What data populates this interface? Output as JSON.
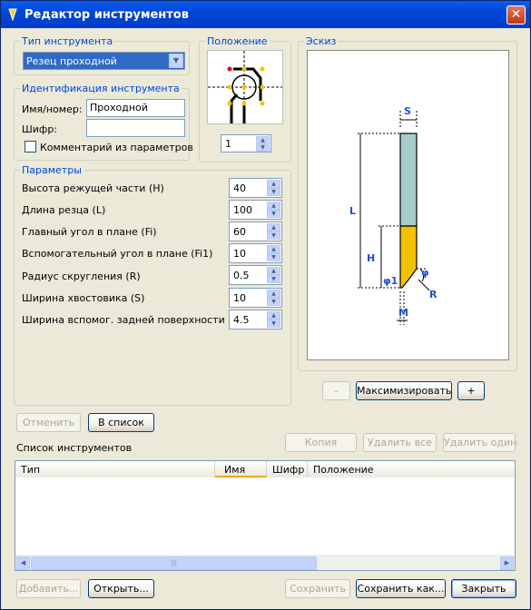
{
  "window": {
    "title": "Редактор инструментов",
    "close_glyph": "✕"
  },
  "tool_type": {
    "legend": "Тип инструмента",
    "selected": "Резец проходной"
  },
  "position": {
    "legend": "Положение",
    "value": "1"
  },
  "sketch": {
    "legend": "Эскиз",
    "labels": {
      "S": "S",
      "L": "L",
      "H": "H",
      "phi1": "φ1",
      "phi": "φ",
      "R": "R",
      "M": "M"
    }
  },
  "identification": {
    "legend": "Идентификация инструмента",
    "name_label": "Имя/номер:",
    "name_value": "Проходной",
    "code_label": "Шифр:",
    "code_value": "",
    "comment_label": "Комментарий из параметров",
    "comment_checked": false
  },
  "parameters": {
    "legend": "Параметры",
    "rows": [
      {
        "label": "Высота режущей части (H)",
        "value": "40"
      },
      {
        "label": "Длина резца (L)",
        "value": "100"
      },
      {
        "label": "Главный угол в плане (Fi)",
        "value": "60"
      },
      {
        "label": "Вспомогательный угол в плане (Fi1)",
        "value": "10"
      },
      {
        "label": "Радиус скругления (R)",
        "value": "0.5"
      },
      {
        "label": "Ширина хвостовика (S)",
        "value": "10"
      },
      {
        "label": "Ширина вспомог. задней поверхности (M)",
        "value": "4.5"
      }
    ]
  },
  "zoom": {
    "minus": "–",
    "maximize": "Максимизировать",
    "plus": "+"
  },
  "edit_buttons": {
    "cancel": "Отменить",
    "to_list": "В список"
  },
  "list_buttons": {
    "copy": "Копия",
    "delete_all": "Удалить все",
    "delete_one": "Удалить один"
  },
  "tool_list": {
    "label": "Список инструментов",
    "columns": [
      "Тип",
      "Имя",
      "Шифр",
      "Положение"
    ],
    "rows": []
  },
  "bottom_buttons": {
    "add": "Добавить...",
    "open": "Открыть...",
    "save": "Сохранить",
    "save_as": "Сохранить как...",
    "close": "Закрыть"
  },
  "colors": {
    "title_bar": "#0a52e0",
    "legend_text": "#0046d5",
    "tool_shank": "#a8cccc",
    "tool_tip": "#f2c200",
    "dimension_text": "#1e50d0"
  }
}
